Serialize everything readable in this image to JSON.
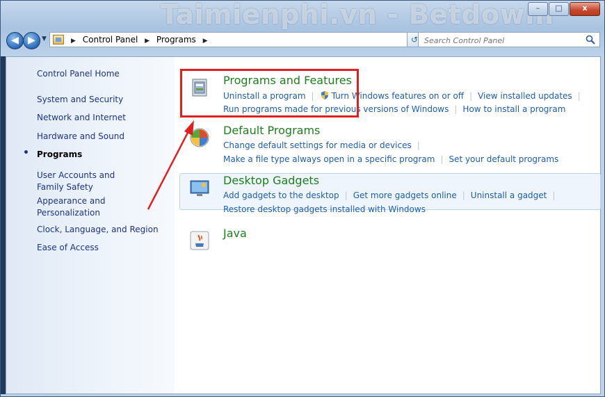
{
  "window": {
    "watermark": "Taimienphi.vn - Betdownl",
    "buttons": {
      "minimize": "–",
      "maximize": "□",
      "close": "x"
    }
  },
  "address_bar": {
    "crumbs": [
      "Control Panel",
      "Programs"
    ],
    "search_placeholder": "Search Control Panel"
  },
  "sidebar": {
    "items": [
      {
        "label": "Control Panel Home"
      },
      {
        "label": "System and Security"
      },
      {
        "label": "Network and Internet"
      },
      {
        "label": "Hardware and Sound"
      },
      {
        "label": "Programs",
        "current": true
      },
      {
        "label": "User Accounts and Family Safety"
      },
      {
        "label": "Appearance and Personalization"
      },
      {
        "label": "Clock, Language, and Region"
      },
      {
        "label": "Ease of Access"
      }
    ]
  },
  "categories": [
    {
      "title": "Programs and Features",
      "links_line1": [
        "Uninstall a program",
        "Turn Windows features on or off",
        "View installed updates"
      ],
      "links_line2": [
        "Run programs made for previous versions of Windows",
        "How to install a program"
      ]
    },
    {
      "title": "Default Programs",
      "links_line1": [
        "Change default settings for media or devices"
      ],
      "links_line2": [
        "Make a file type always open in a specific program",
        "Set your default programs"
      ]
    },
    {
      "title": "Desktop Gadgets",
      "links_line1": [
        "Add gadgets to the desktop",
        "Get more gadgets online",
        "Uninstall a gadget"
      ],
      "links_line2": [
        "Restore desktop gadgets installed with Windows"
      ]
    },
    {
      "title": "Java"
    }
  ],
  "colors": {
    "category_title": "#1e7f1e",
    "link": "#1e5eb0",
    "annotation": "#e02020"
  }
}
